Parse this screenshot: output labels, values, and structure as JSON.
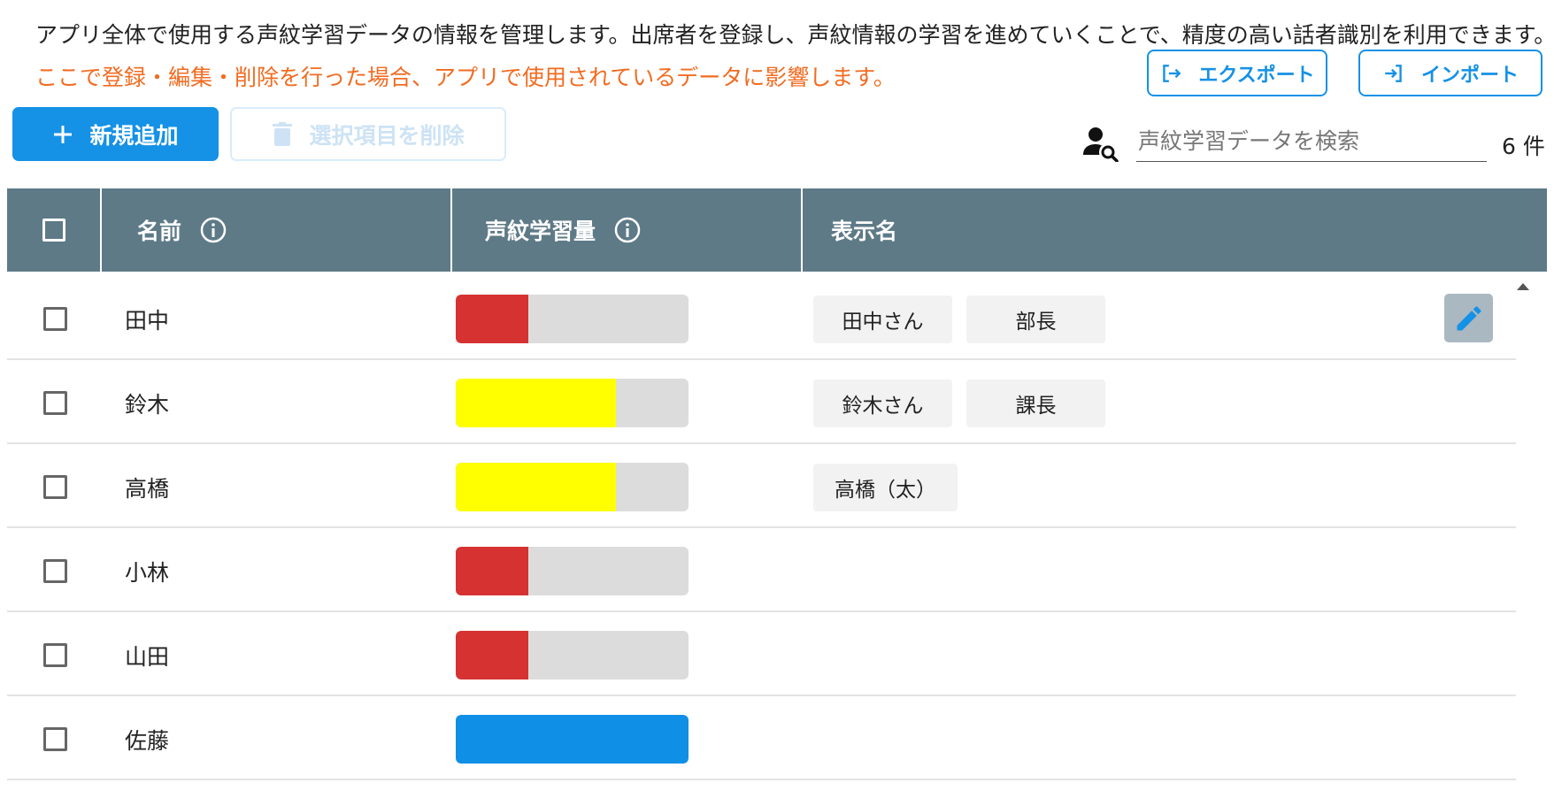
{
  "description": "アプリ全体で使用する声紋学習データの情報を管理します。出席者を登録し、声紋情報の学習を進めていくことで、精度の高い話者識別を利用できます。",
  "warning": "ここで登録・編集・削除を行った場合、アプリで使用されているデータに影響します。",
  "toolbar": {
    "export_label": "エクスポート",
    "import_label": "インポート",
    "add_label": "新規追加",
    "delete_label": "選択項目を削除",
    "search_placeholder": "声紋学習データを検索",
    "count_label": "6 件"
  },
  "table": {
    "headers": {
      "name": "名前",
      "amount": "声紋学習量",
      "display": "表示名"
    },
    "rows": [
      {
        "name": "田中",
        "level": 0.31,
        "level_color": "#d63232",
        "display_names": [
          "田中さん",
          "部長"
        ],
        "editable": true
      },
      {
        "name": "鈴木",
        "level": 0.69,
        "level_color": "#ffff00",
        "display_names": [
          "鈴木さん",
          "課長"
        ],
        "editable": false
      },
      {
        "name": "高橋",
        "level": 0.69,
        "level_color": "#ffff00",
        "display_names": [
          "高橋（太）"
        ],
        "editable": false
      },
      {
        "name": "小林",
        "level": 0.31,
        "level_color": "#d63232",
        "display_names": [],
        "editable": false
      },
      {
        "name": "山田",
        "level": 0.31,
        "level_color": "#d63232",
        "display_names": [],
        "editable": false
      },
      {
        "name": "佐藤",
        "level": 1.0,
        "level_color": "#0f8fe6",
        "display_names": [],
        "editable": false
      }
    ]
  },
  "colors": {
    "accent": "#1591e6",
    "warning": "#f26b21",
    "header_bg": "#5e7a87"
  },
  "icons": {
    "export": "export-icon",
    "import": "import-icon",
    "add": "plus-icon",
    "delete": "trash-icon",
    "search": "person-search-icon",
    "info": "info-icon",
    "edit": "pencil-icon"
  }
}
